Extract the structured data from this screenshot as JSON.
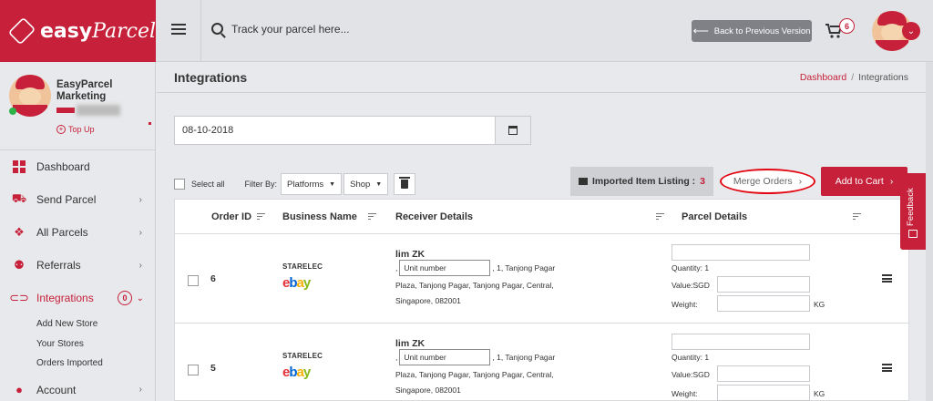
{
  "brand": {
    "name_plain": "easy",
    "name_script": "Parcel"
  },
  "header": {
    "search_placeholder": "Track your parcel here...",
    "back_button": "Back to Previous Version",
    "cart_count": "6"
  },
  "profile": {
    "name": "EasyParcel Marketing",
    "topup": "Top Up"
  },
  "sidebar": {
    "items": [
      {
        "label": "Dashboard",
        "icon": "dashboard-icon"
      },
      {
        "label": "Send Parcel",
        "icon": "truck-icon"
      },
      {
        "label": "All Parcels",
        "icon": "boxes-icon"
      },
      {
        "label": "Referrals",
        "icon": "users-icon"
      },
      {
        "label": "Integrations",
        "icon": "link-icon",
        "badge": "0"
      },
      {
        "label": "Account",
        "icon": "account-icon"
      }
    ],
    "subitems": [
      "Add New Store",
      "Your Stores",
      "Orders Imported"
    ]
  },
  "page": {
    "title": "Integrations",
    "breadcrumb_home": "Dashboard",
    "breadcrumb_sep": "/",
    "breadcrumb_current": "Integrations",
    "date_value": "08-10-2018"
  },
  "toolbar": {
    "select_all": "Select all",
    "filter_by": "Filter By:",
    "platforms": "Platforms",
    "shop": "Shop",
    "imported_label": "Imported Item Listing :",
    "imported_count": "3",
    "merge_orders": "Merge Orders",
    "add_to_cart": "Add to Cart"
  },
  "table": {
    "headers": [
      "Order ID",
      "Business Name",
      "Receiver Details",
      "Parcel Details"
    ],
    "rows": [
      {
        "order_id": "6",
        "business": "STARELEC",
        "platform": "ebay",
        "receiver_name": "lim ZK",
        "unit_placeholder": "Unit number",
        "addr1": ", 1, Tanjong Pagar",
        "addr2": "Plaza, Tanjong Pagar, Tanjong Pagar, Central,",
        "addr3": "Singapore, 082001",
        "quantity": "Quantity: 1",
        "value_label": "Value:SGD",
        "weight_label": "Weight:",
        "kg": "KG"
      },
      {
        "order_id": "5",
        "business": "STARELEC",
        "platform": "ebay",
        "receiver_name": "lim ZK",
        "unit_placeholder": "Unit number",
        "addr1": ", 1, Tanjong Pagar",
        "addr2": "Plaza, Tanjong Pagar, Tanjong Pagar, Central,",
        "addr3": "Singapore, 082001",
        "quantity": "Quantity: 1",
        "value_label": "Value:SGD",
        "weight_label": "Weight:",
        "kg": "KG"
      }
    ]
  },
  "feedback": "Feedback",
  "colors": {
    "brand": "#c6203a",
    "highlight": "#e30613"
  }
}
